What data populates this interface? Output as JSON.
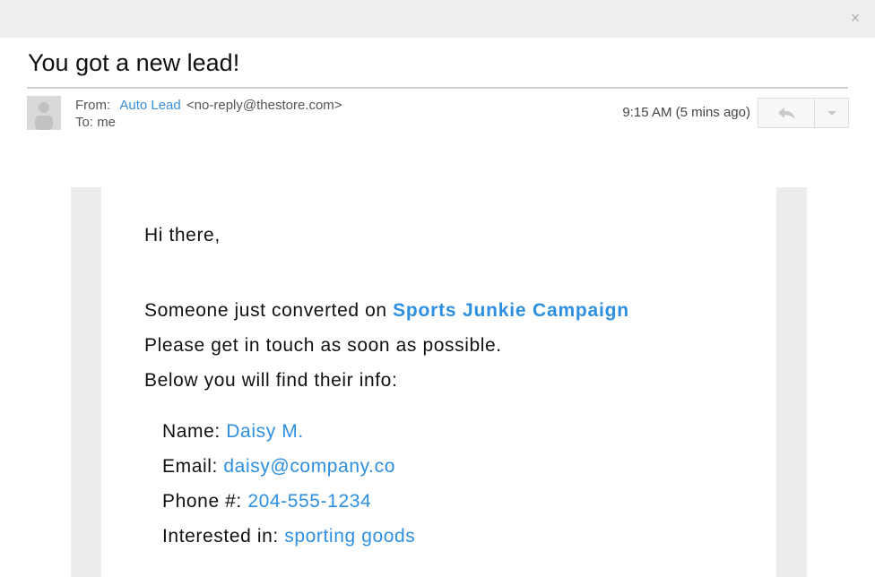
{
  "window": {
    "close_glyph": "×"
  },
  "email": {
    "subject": "You got a new lead!",
    "from_label": "From:",
    "from_name": "Auto Lead",
    "from_address": "<no-reply@thestore.com>",
    "to_label": "To:",
    "to_value": "me",
    "time": "9:15 AM (5 mins ago)"
  },
  "body": {
    "greeting": "Hi there,",
    "line1_prefix": "Someone just converted on",
    "campaign": "Sports Junkie Campaign",
    "line2": "Please get in touch as soon as possible.",
    "line3": "Below you will find their info:",
    "fields": {
      "name_label": "Name:",
      "name_value": "Daisy M.",
      "email_label": "Email:",
      "email_value": "daisy@company.co",
      "phone_label": "Phone #:",
      "phone_value": "204-555-1234",
      "interest_label": "Interested in:",
      "interest_value": "sporting goods"
    }
  },
  "colors": {
    "link": "#2e8fe0",
    "topbar": "#eeeeee",
    "panel": "#ececec"
  },
  "icons": {
    "reply": "reply-icon",
    "more": "chevron-down-icon",
    "avatar": "person-icon",
    "close": "close-icon"
  }
}
